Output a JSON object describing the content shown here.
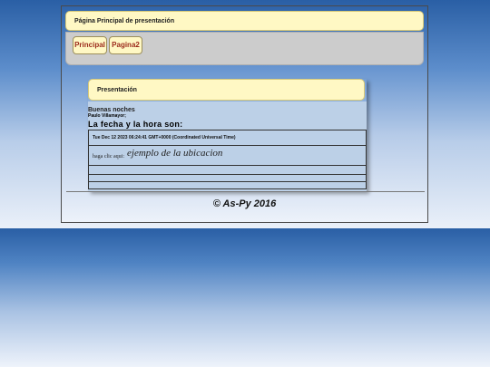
{
  "header": {
    "title": "Página Principal de presentación"
  },
  "nav": {
    "items": [
      {
        "label": "Principal"
      },
      {
        "label": "Pagina2"
      }
    ]
  },
  "panel": {
    "title": "Presentación",
    "greeting": "Buenas noches",
    "user": "Paulo Villamayor;",
    "date_heading": "La fecha y la hora son:",
    "date_value": "Tue Dec 12 2023 06:24:41 GMT+0000 (Coordinated Universal Time)",
    "click_prefix": "haga clic aqui:",
    "location_link": "ejemplo de la ubicacion"
  },
  "footer": {
    "text": "© As-Py 2016"
  }
}
